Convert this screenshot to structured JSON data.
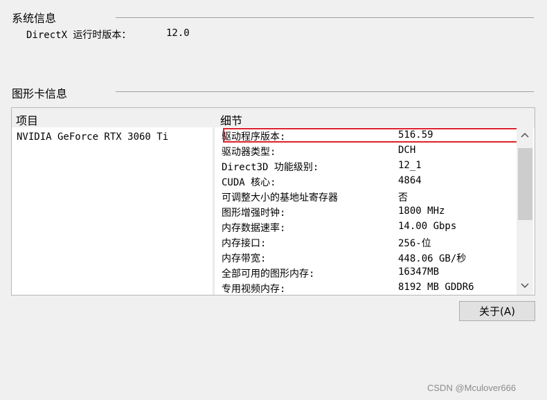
{
  "system_info": {
    "title": "系统信息",
    "directx_label": "DirectX 运行时版本：",
    "directx_value": "12.0"
  },
  "graphics_info": {
    "title": "图形卡信息",
    "columns": {
      "item": "项目",
      "detail": "细节"
    },
    "device": "NVIDIA GeForce RTX 3060 Ti",
    "details": [
      {
        "label": "驱动程序版本:",
        "value": "516.59"
      },
      {
        "label": "驱动器类型:",
        "value": "DCH"
      },
      {
        "label": "Direct3D 功能级别:",
        "value": "12_1"
      },
      {
        "label": "CUDA 核心:",
        "value": "4864"
      },
      {
        "label": "可调整大小的基地址寄存器",
        "value": "否"
      },
      {
        "label": "图形增强时钟:",
        "value": "1800 MHz"
      },
      {
        "label": "内存数据速率:",
        "value": "14.00 Gbps"
      },
      {
        "label": "内存接口:",
        "value": "256-位"
      },
      {
        "label": "内存带宽:",
        "value": "448.06 GB/秒"
      },
      {
        "label": "全部可用的图形内存:",
        "value": "16347MB"
      },
      {
        "label": "专用视频内存:",
        "value": "8192 MB GDDR6"
      }
    ],
    "highlight_color": "#e0202a"
  },
  "buttons": {
    "about": "关于(A)"
  },
  "icons": {
    "scroll_up": "chevron-up-icon",
    "scroll_down": "chevron-down-icon"
  },
  "watermark": "CSDN @Mculover666"
}
